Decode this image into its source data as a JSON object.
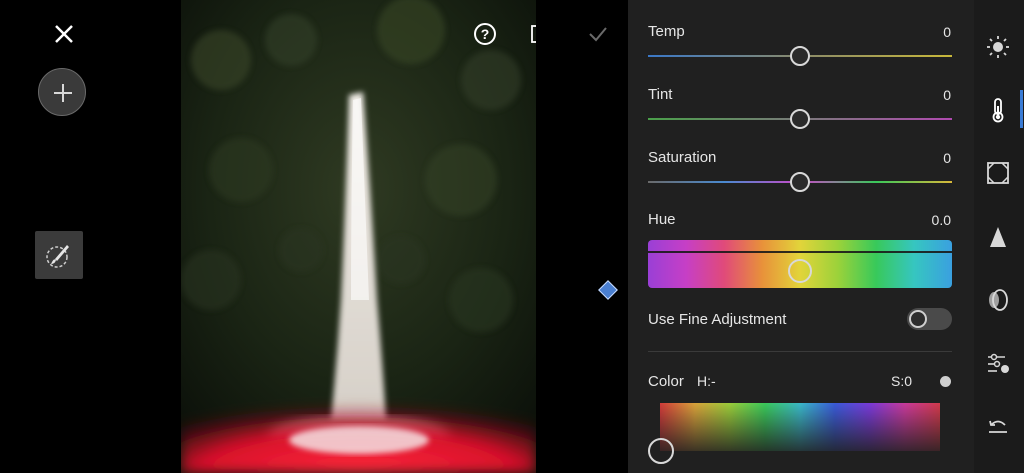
{
  "panel": {
    "temp": {
      "label": "Temp",
      "value": "0",
      "position": 0.5
    },
    "tint": {
      "label": "Tint",
      "value": "0",
      "position": 0.5
    },
    "saturation": {
      "label": "Saturation",
      "value": "0",
      "position": 0.5
    },
    "hue": {
      "label": "Hue",
      "value": "0.0",
      "position": 0.5
    },
    "fine_adjustment": {
      "label": "Use Fine Adjustment",
      "enabled": false
    },
    "color": {
      "label": "Color",
      "h_label": "H:-",
      "s_label": "S:0"
    }
  },
  "left_toolbar": {
    "close_icon": "close-icon",
    "add_icon": "add-icon",
    "brush_icon": "brush-icon"
  },
  "top_toolbar": {
    "help_icon": "help-icon",
    "compare_icon": "compare-icon",
    "check_icon": "checkmark-icon"
  },
  "rail": [
    "light-icon",
    "color-temp-icon",
    "geometry-icon",
    "effects-icon",
    "optics-icon",
    "detail-icon",
    "undo-icon"
  ],
  "colors": {
    "accent": "#3a7bd5",
    "panel_bg": "#202020",
    "mask_overlay": "#e0102a"
  }
}
